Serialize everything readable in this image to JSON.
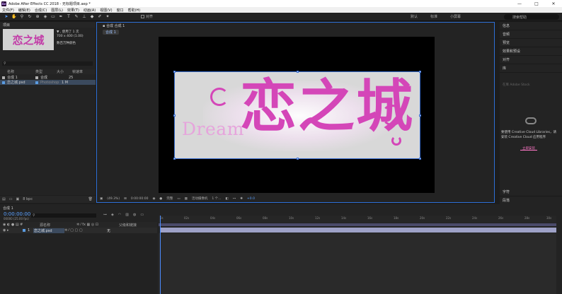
{
  "titlebar": {
    "title": "Adobe After Effects CC 2018 - 无标题项目.aep *",
    "app_icon": "Ae",
    "minimize": "—",
    "maximize": "□",
    "close": "✕"
  },
  "menu": [
    "文件(F)",
    "编辑(E)",
    "合成(C)",
    "图层(L)",
    "效果(T)",
    "动画(A)",
    "视图(V)",
    "窗口",
    "帮助(H)"
  ],
  "toolbar": {
    "tools": [
      "selection-tool",
      "hand-tool",
      "zoom-tool",
      "rotate-tool",
      "camera-tool",
      "pan-behind-tool",
      "rectangle-tool",
      "pen-tool",
      "type-tool",
      "brush-tool",
      "clone-tool",
      "eraser-tool",
      "roto-tool",
      "puppet-tool"
    ],
    "snap_label": "对齐",
    "workspaces": [
      "默认",
      "标准",
      "小屏幕"
    ],
    "search_help_placeholder": "搜索帮助"
  },
  "project": {
    "tab_label": "项目",
    "thumb_title": "恋之城",
    "file_info": "▼ , 使用了 1 次",
    "file_dims": "700 x 400 (1.00)",
    "file_colors": "数百万种颜色",
    "search_placeholder": "",
    "columns": {
      "name": "名称",
      "type": "类型",
      "size": "大小",
      "rate": "帧速率"
    },
    "rows": [
      {
        "name": "合成 1",
        "type": "合成",
        "size": "",
        "rate": "25",
        "color": "#b0b0b0",
        "selected": false
      },
      {
        "name": "恋之城.psd",
        "type": "Photoshop",
        "size": "1 M",
        "rate": "",
        "color": "#5a9be0",
        "selected": true
      }
    ],
    "footer_bpc": "8 bpc"
  },
  "composition": {
    "tab_label": "合成 合成 1",
    "flow_label": "合成 1",
    "artwork": {
      "big_text": "恋之城",
      "small_text": "Dream"
    },
    "zoom": "(49.3%)",
    "timecode": "0:00:00:00",
    "resolution": "完整",
    "camera": "活动摄像机",
    "views": "1 个...",
    "offset": "+0.0"
  },
  "right_panel": {
    "items": [
      "信息",
      "音频",
      "预览",
      "效果和预设",
      "对齐",
      "库"
    ],
    "library_placeholder": "在库 Adobe Stock",
    "cc_message": "要使用 Creative Cloud Libraries，请安装 Creative Cloud 应用程序",
    "cc_button": "立即安装",
    "bottom_items": [
      "字符",
      "段落"
    ]
  },
  "timeline": {
    "tab_label": "合成 1",
    "timecode": "0:00:00:00",
    "fps": "00000 (25.00 fps)",
    "layer_head": {
      "source_name": "源名称",
      "parent": "父级和链接"
    },
    "layer": {
      "index": "1",
      "name": "恋之城.psd",
      "parent": "无"
    },
    "ruler_ticks": [
      "0s",
      "02s",
      "04s",
      "06s",
      "08s",
      "10s",
      "12s",
      "14s",
      "16s",
      "18s",
      "20s",
      "22s",
      "24s",
      "26s",
      "28s",
      "30s"
    ]
  }
}
